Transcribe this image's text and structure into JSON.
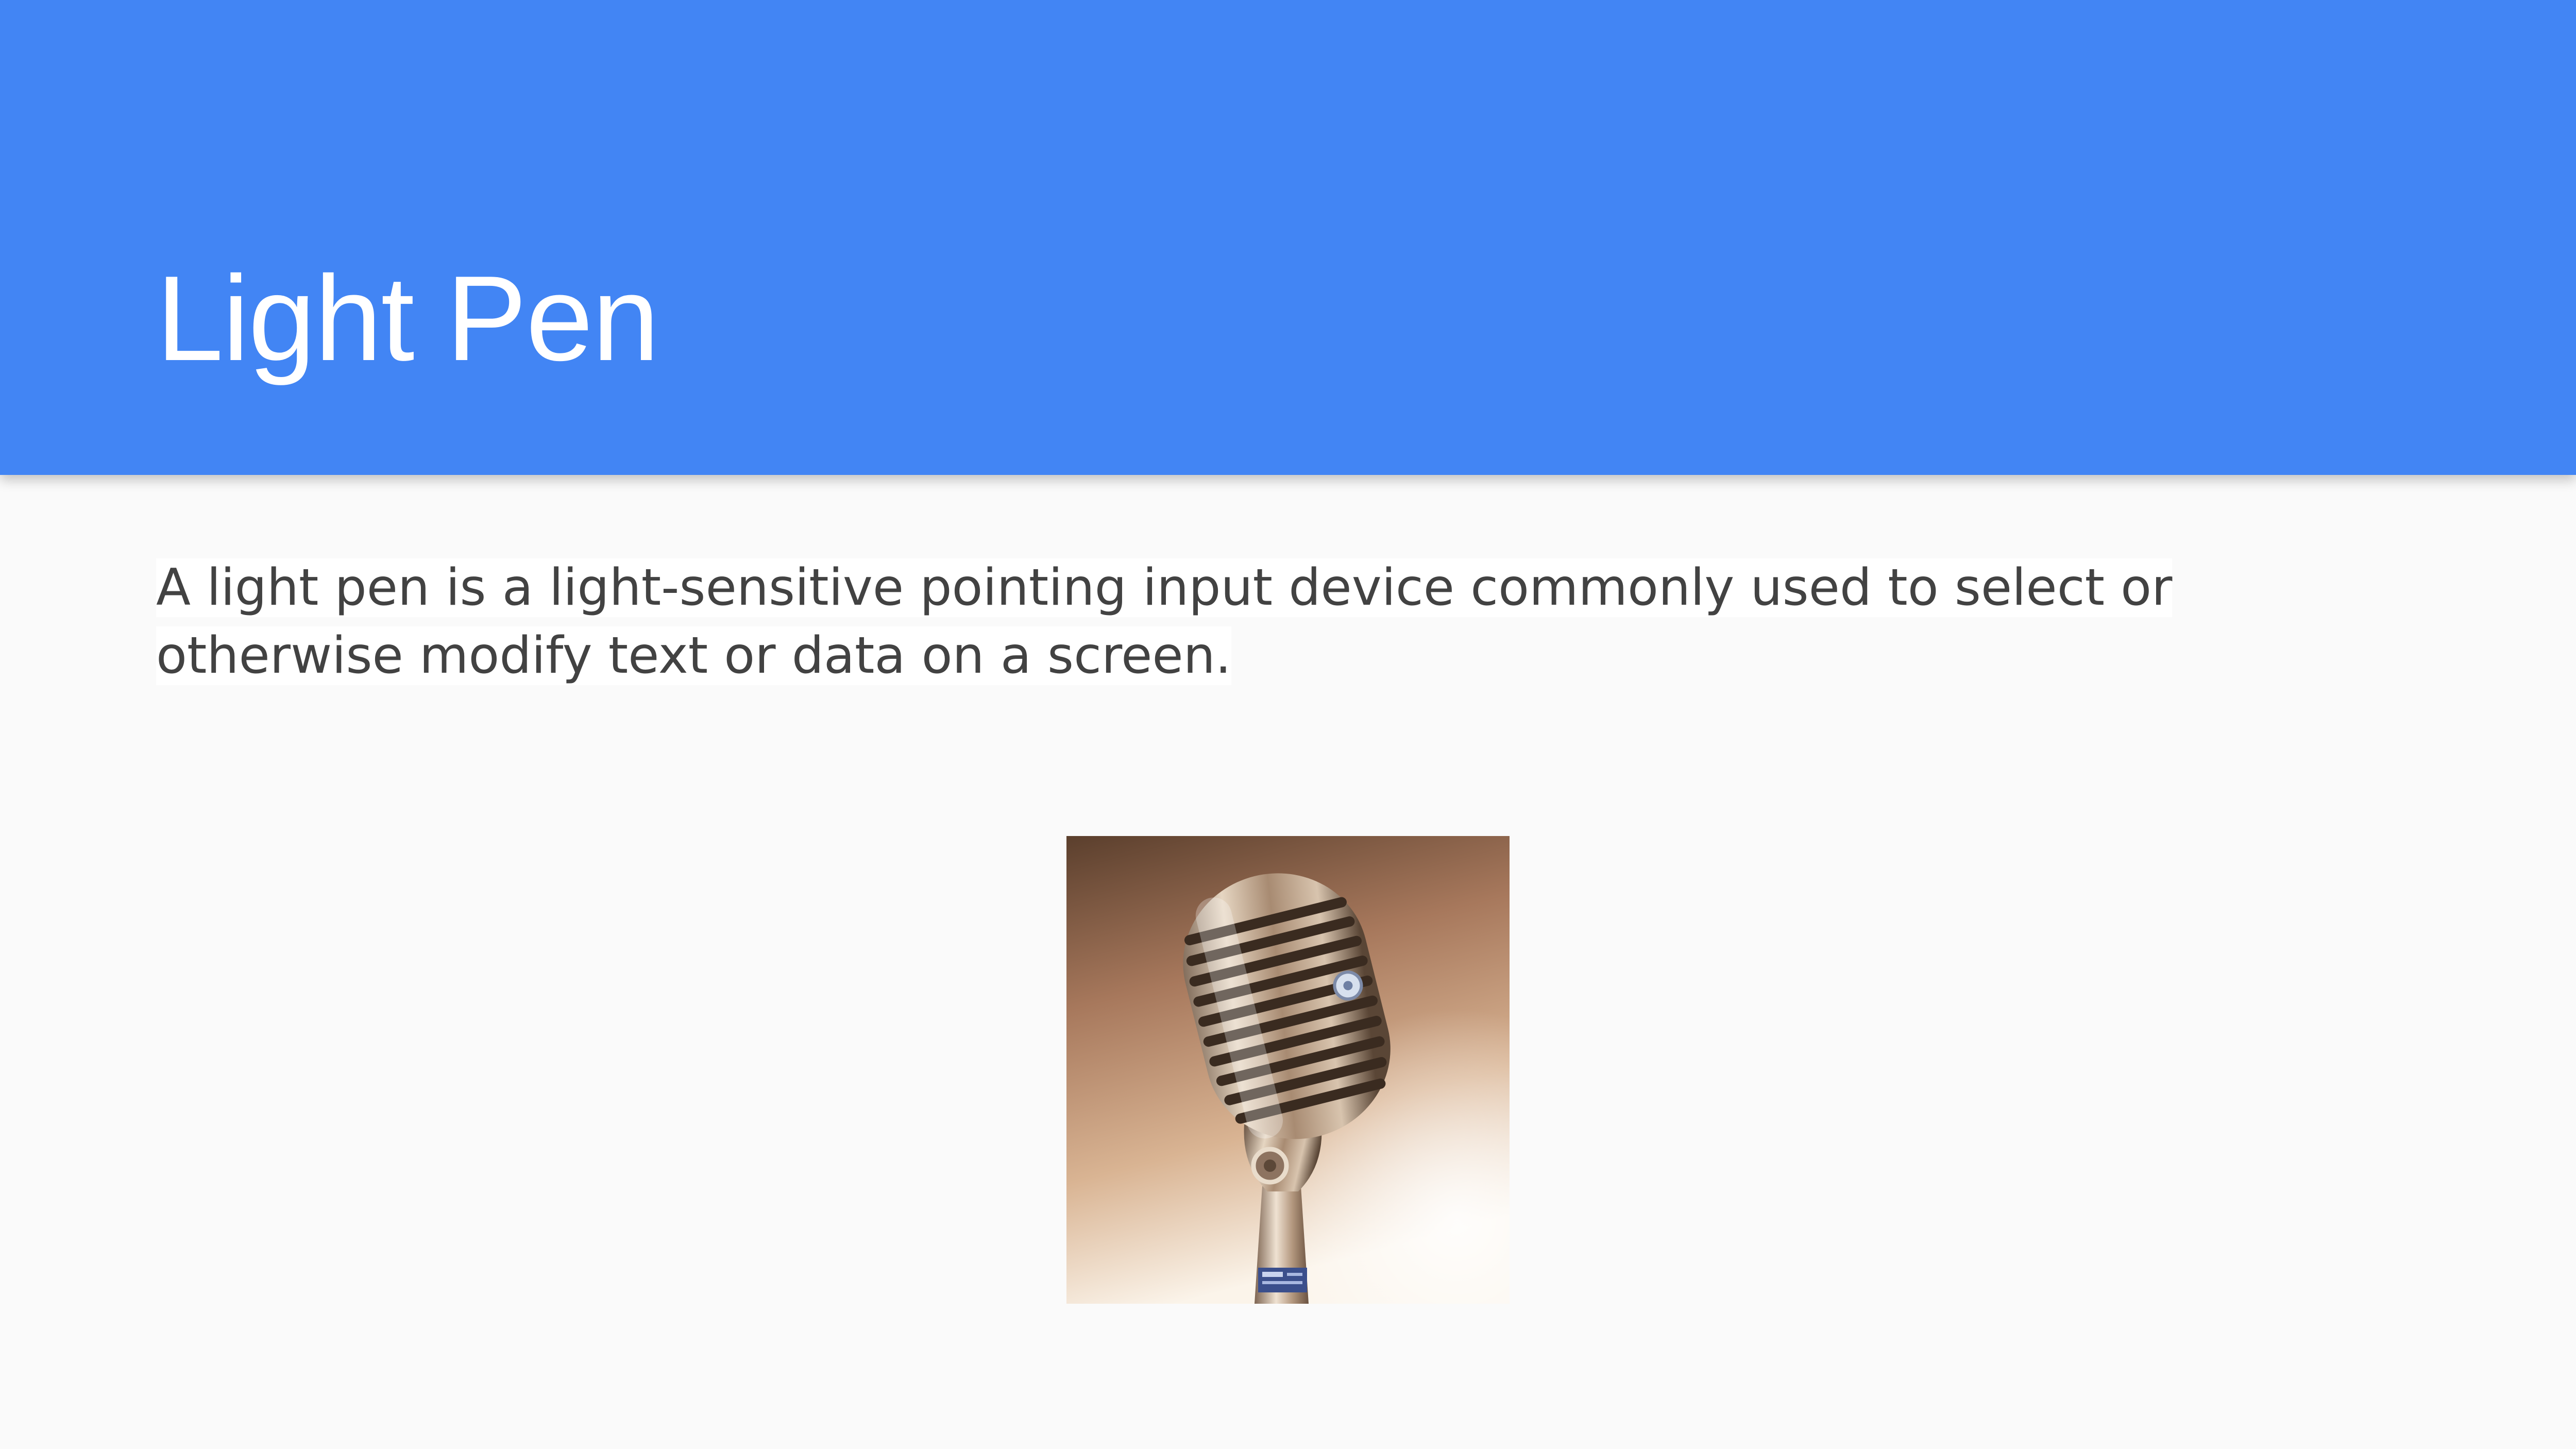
{
  "slide": {
    "title": "Light Pen",
    "body": "A light pen is a light-sensitive pointing input device commonly used to select or otherwise modify text or data on a screen."
  },
  "image": {
    "subject": "vintage-microphone"
  },
  "colors": {
    "header": "#4285f4",
    "background": "#fafafa",
    "title_text": "#ffffff",
    "body_text": "#424242"
  }
}
